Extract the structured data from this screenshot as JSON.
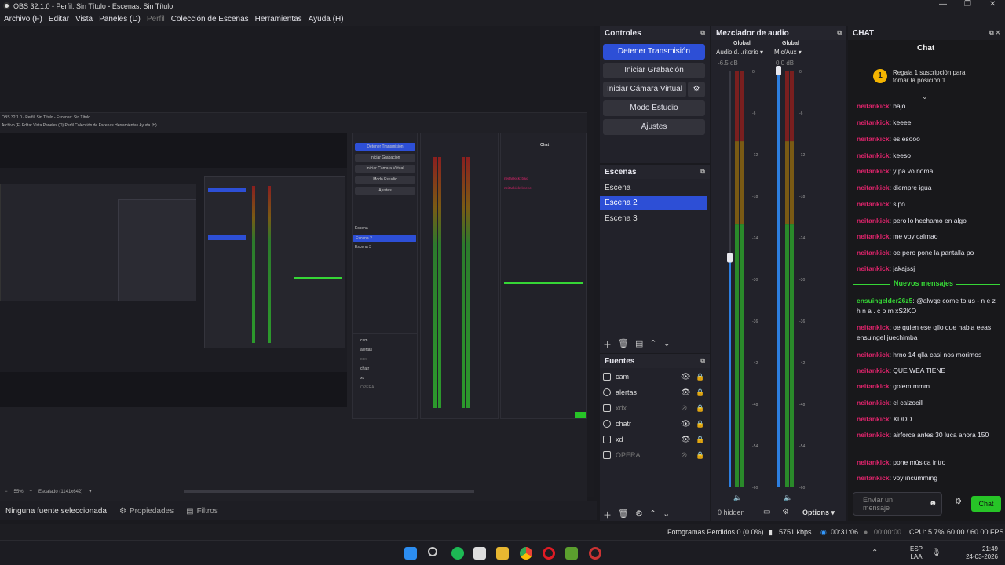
{
  "window": {
    "title": "OBS 32.1.0 - Perfil: Sin Título - Escenas: Sin Título"
  },
  "menu": [
    "Archivo (F)",
    "Editar",
    "Vista",
    "Paneles (D)",
    "Perfil",
    "Colección de Escenas",
    "Herramientas",
    "Ayuda (H)"
  ],
  "nested": {
    "title": "OBS 32.1.0 - Perfil: Sin Título - Escenas: Sin Título",
    "menu": "Archivo (F)   Editar   Vista   Paneles (D)   Perfil   Colección de Escenas   Herramientas   Ayuda (H)",
    "footer_zoom": "55%",
    "footer_scale": "Escalado (1141x642)",
    "source_none": "Ninguna fuente seleccionada",
    "props": "Propiedades",
    "filters": "Filtros"
  },
  "controls": {
    "title": "Controles",
    "stop_stream": "Detener Transmisión",
    "start_rec": "Iniciar Grabación",
    "virtual_cam": "Iniciar Cámara Virtual",
    "studio_mode": "Modo Estudio",
    "settings": "Ajustes"
  },
  "scenes": {
    "title": "Escenas",
    "items": [
      "Escena",
      "Escena 2",
      "Escena 3"
    ]
  },
  "sources": {
    "title": "Fuentes",
    "items": [
      "cam",
      "alertas",
      "xdx",
      "chatr",
      "xd",
      "OPERA"
    ]
  },
  "mixer": {
    "title": "Mezclador de audio",
    "global1": "Global",
    "global2": "Global",
    "ch1": "Audio d...ritorio",
    "ch2": "Mic/Aux",
    "db1": "-6.5 dB",
    "db2": "0.0 dB",
    "hidden": "0 hidden",
    "options": "Options",
    "ticks": [
      "0",
      "-6",
      "-12",
      "-18",
      "-24",
      "-30",
      "-36",
      "-42",
      "-48",
      "-54",
      "-60"
    ],
    "ch1_volume_percent": 55,
    "ch2_volume_percent": 100
  },
  "chat": {
    "title": "CHAT",
    "header": "Chat",
    "promo": "Regala 1 suscripción para tomar la posición 1",
    "promo_badge": "1",
    "new_msgs": "Nuevos mensajes",
    "placeholder": "Enviar un mensaje",
    "send": "Chat",
    "messages": [
      {
        "user": "neitankick",
        "text": ": bajo"
      },
      {
        "user": "neitankick",
        "text": ": keeee"
      },
      {
        "user": "neitankick",
        "text": ": es esooo"
      },
      {
        "user": "neitankick",
        "text": ": keeso"
      },
      {
        "user": "neitankick",
        "text": ": y pa vo noma"
      },
      {
        "user": "neitankick",
        "text": ": diempre igua"
      },
      {
        "user": "neitankick",
        "text": ": sipo"
      },
      {
        "user": "neitankick",
        "text": ": pero lo hechamo en algo"
      },
      {
        "user": "neitankick",
        "text": ": me voy calmao"
      },
      {
        "user": "neitankick",
        "text": ": oe pero pone la pantalla po"
      },
      {
        "user": "neitankick",
        "text": ": jakajssj"
      }
    ],
    "messages_after": [
      {
        "user": "ensuingelder26z5",
        "text": ": @alwqe come to us - n e z h n a . c o m xS2KO",
        "green": true
      },
      {
        "user": "neitankick",
        "text": ": oe quien ese qllo que habla eeas ensuingel juechimba"
      },
      {
        "user": "neitankick",
        "text": ": hrno 14 qlla casi nos morimos"
      },
      {
        "user": "neitankick",
        "text": ": QUE WEA TIENE"
      },
      {
        "user": "neitankick",
        "text": ": golem mmm"
      },
      {
        "user": "neitankick",
        "text": ": el calzocill"
      },
      {
        "user": "neitankick",
        "text": ": XDDD"
      },
      {
        "user": "neitankick",
        "text": ": airforce antes 30 luca ahora 150"
      },
      {
        "user": "neitankick",
        "text": ": pone música intro"
      },
      {
        "user": "neitankick",
        "text": ": voy incumming"
      }
    ]
  },
  "status": {
    "frames": "Fotogramas Perdidos 0 (0.0%)",
    "kbps": "5751 kbps",
    "stream_time": "00:31:06",
    "rec_time": "00:00:00",
    "cpu": "CPU: 5.7%",
    "fps": "60.00 / 60.00 FPS"
  },
  "taskbar": {
    "lang1": "ESP",
    "lang2": "LAA",
    "time": "21:49",
    "date": "24-03-2026"
  },
  "colors": {
    "accent": "#2d4fd6",
    "chat_user": "#e0246c",
    "chat_green": "#36d636",
    "send_button": "#27c427"
  }
}
